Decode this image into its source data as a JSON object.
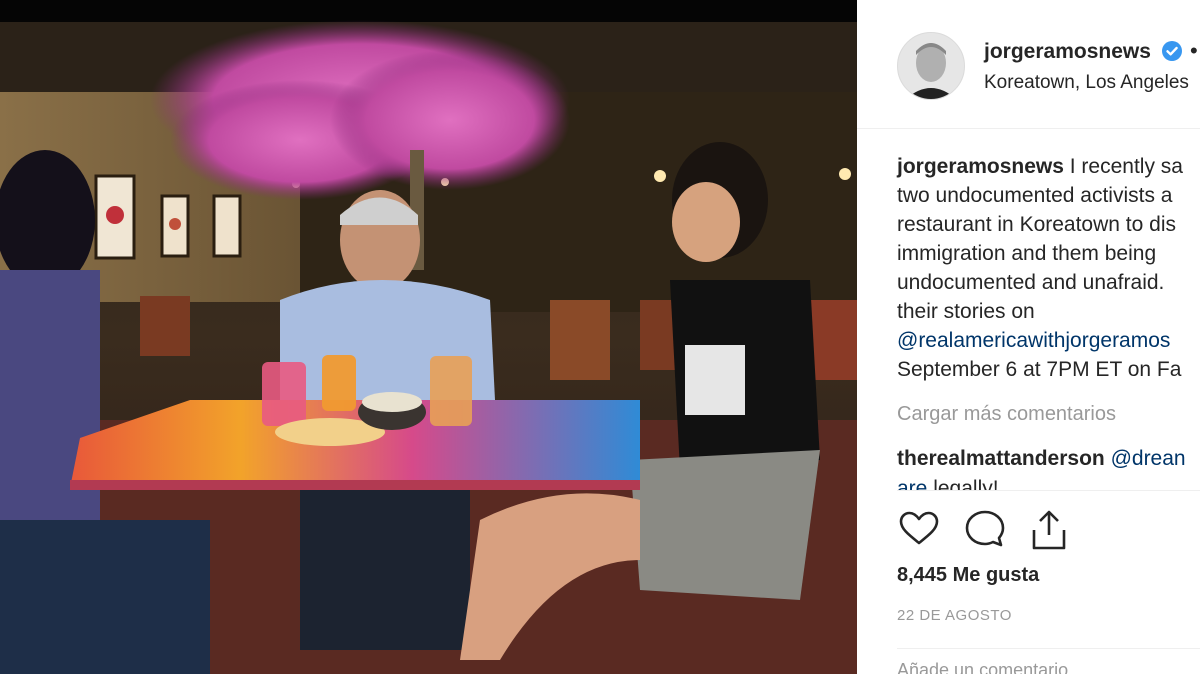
{
  "post": {
    "username": "jorgeramosnews",
    "more_dot": "•",
    "location": "Koreatown, Los Angeles"
  },
  "caption": {
    "username": "jorgeramosnews",
    "lines": [
      " I recently sa",
      "two undocumented activists a",
      "restaurant in Koreatown to dis",
      "immigration and them being",
      "undocumented and unafraid.",
      "their stories on",
      "@realamericawithjorgeramos",
      "September 6 at 7PM ET on Fa"
    ]
  },
  "load_more": "Cargar más comentarios",
  "comment": {
    "username": "therealmattanderson",
    "text_1": " @drean",
    "text_2": "are",
    "text_3": " legally!"
  },
  "actions": {
    "like_icon": "heart-icon",
    "comment_icon": "comment-bubble-icon",
    "share_icon": "share-upload-icon"
  },
  "likes_text": "8,445 Me gusta",
  "date_text": "22 DE AGOSTO",
  "add_comment_placeholder": "Añade un comentario...",
  "colors": {
    "text": "#262626",
    "muted": "#999999",
    "link": "#003569",
    "verified": "#3897f0",
    "border": "#efefef"
  }
}
